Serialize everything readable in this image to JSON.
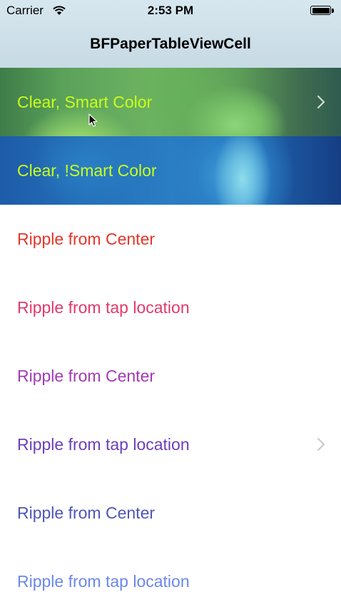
{
  "status_bar": {
    "carrier": "Carrier",
    "time": "2:53 PM"
  },
  "nav": {
    "title": "BFPaperTableViewCell"
  },
  "cells": [
    {
      "label": "Clear, Smart Color",
      "color": "#c9ff1a",
      "has_chevron": true
    },
    {
      "label": "Clear, !Smart Color",
      "color": "#c9ff1a",
      "has_chevron": false
    },
    {
      "label": "Ripple from Center",
      "color": "#e2372b",
      "has_chevron": false
    },
    {
      "label": "Ripple from tap location",
      "color": "#e13a6b",
      "has_chevron": false
    },
    {
      "label": "Ripple from Center",
      "color": "#a23bb3",
      "has_chevron": false
    },
    {
      "label": "Ripple from tap location",
      "color": "#6d3fb8",
      "has_chevron": true
    },
    {
      "label": "Ripple from Center",
      "color": "#4e56b8",
      "has_chevron": false
    },
    {
      "label": "Ripple from tap location",
      "color": "#6b88ea",
      "has_chevron": false
    }
  ],
  "icons": {
    "wifi": "wifi-icon",
    "battery": "battery-icon",
    "chevron": "chevron-right-icon",
    "cursor": "mouse-pointer-icon"
  }
}
